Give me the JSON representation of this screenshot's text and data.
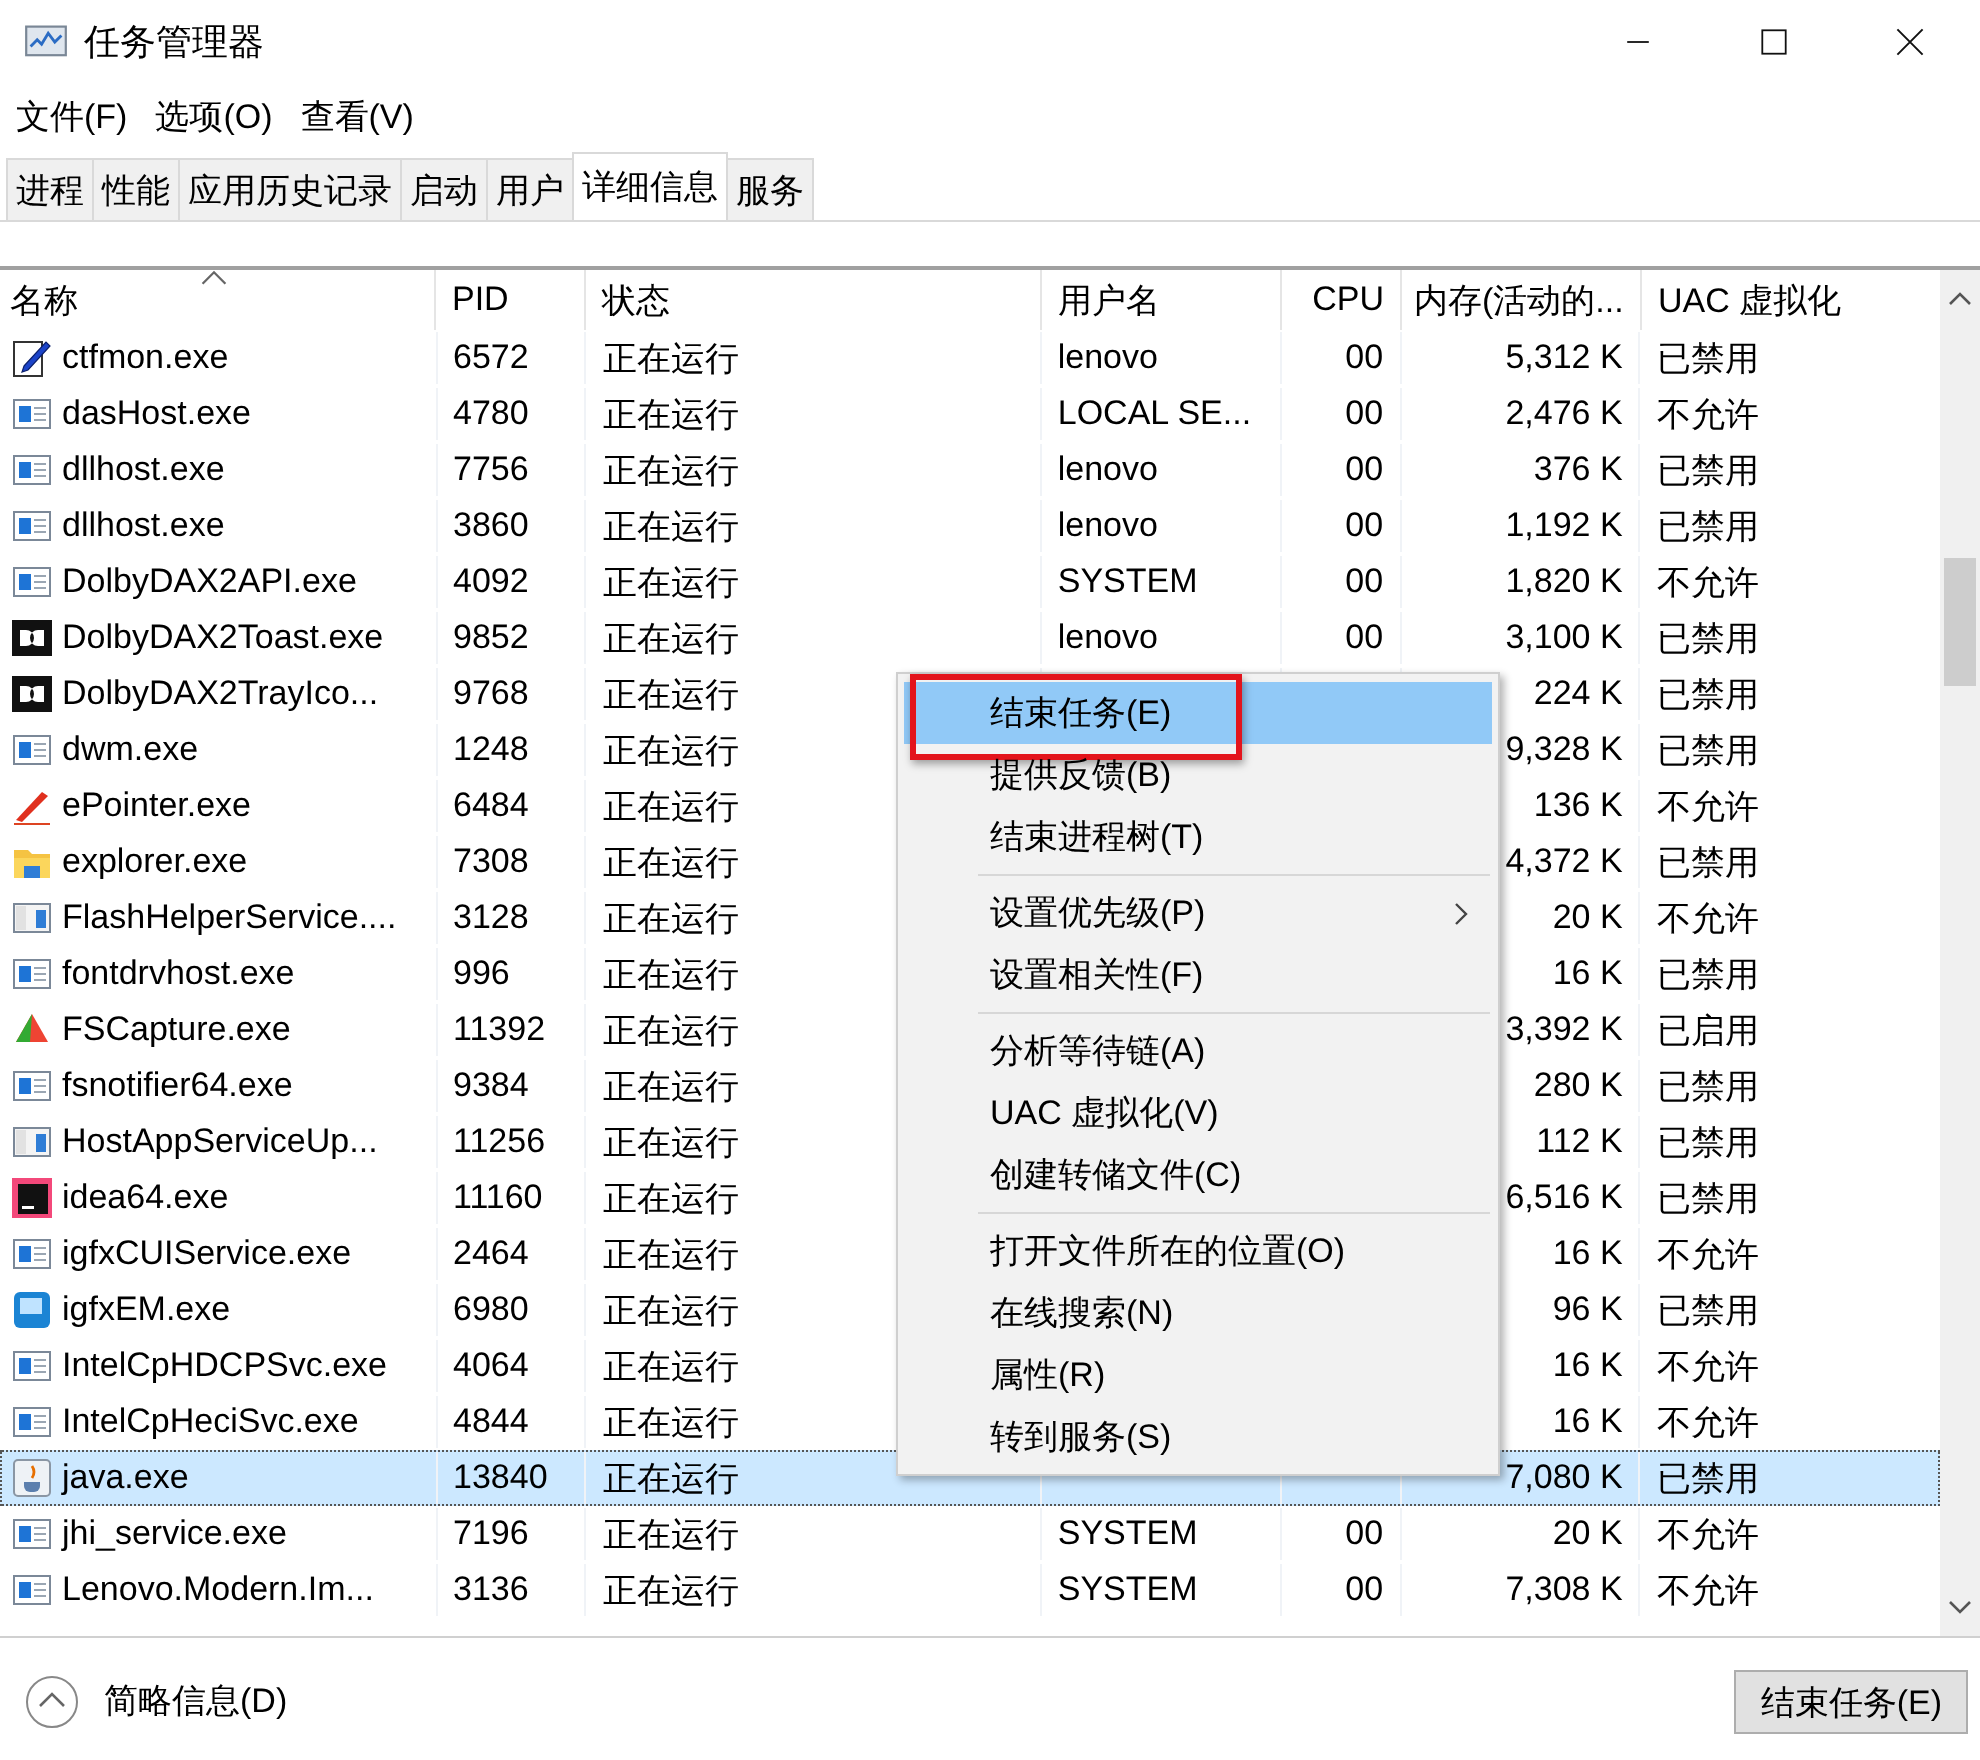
{
  "window": {
    "title": "任务管理器"
  },
  "menu_bar": [
    "文件(F)",
    "选项(O)",
    "查看(V)"
  ],
  "tabs": [
    {
      "label": "进程",
      "selected": false
    },
    {
      "label": "性能",
      "selected": false
    },
    {
      "label": "应用历史记录",
      "selected": false
    },
    {
      "label": "启动",
      "selected": false
    },
    {
      "label": "用户",
      "selected": false
    },
    {
      "label": "详细信息",
      "selected": true
    },
    {
      "label": "服务",
      "selected": false
    }
  ],
  "table": {
    "columns": [
      {
        "label": "名称",
        "sorted": true
      },
      {
        "label": "PID",
        "sorted": false
      },
      {
        "label": "状态",
        "sorted": false
      },
      {
        "label": "用户名",
        "sorted": false
      },
      {
        "label": "CPU",
        "sorted": false
      },
      {
        "label": "内存(活动的...",
        "sorted": false
      },
      {
        "label": "UAC 虚拟化",
        "sorted": false
      }
    ],
    "rows": [
      {
        "kind": "notepad",
        "name": "ctfmon.exe",
        "pid": "6572",
        "status": "正在运行",
        "user": "lenovo",
        "cpu": "00",
        "memory": "5,312 K",
        "uac": "已禁用",
        "selected": false
      },
      {
        "kind": "window",
        "name": "dasHost.exe",
        "pid": "4780",
        "status": "正在运行",
        "user": "LOCAL SE...",
        "cpu": "00",
        "memory": "2,476 K",
        "uac": "不允许",
        "selected": false
      },
      {
        "kind": "window",
        "name": "dllhost.exe",
        "pid": "7756",
        "status": "正在运行",
        "user": "lenovo",
        "cpu": "00",
        "memory": "376 K",
        "uac": "已禁用",
        "selected": false
      },
      {
        "kind": "window",
        "name": "dllhost.exe",
        "pid": "3860",
        "status": "正在运行",
        "user": "lenovo",
        "cpu": "00",
        "memory": "1,192 K",
        "uac": "已禁用",
        "selected": false
      },
      {
        "kind": "window",
        "name": "DolbyDAX2API.exe",
        "pid": "4092",
        "status": "正在运行",
        "user": "SYSTEM",
        "cpu": "00",
        "memory": "1,820 K",
        "uac": "不允许",
        "selected": false
      },
      {
        "kind": "dolby",
        "name": "DolbyDAX2Toast.exe",
        "pid": "9852",
        "status": "正在运行",
        "user": "lenovo",
        "cpu": "00",
        "memory": "3,100 K",
        "uac": "已禁用",
        "selected": false
      },
      {
        "kind": "dolby",
        "name": "DolbyDAX2TrayIco...",
        "pid": "9768",
        "status": "正在运行",
        "memory": "224 K",
        "uac": "已禁用",
        "selected": false
      },
      {
        "kind": "window",
        "name": "dwm.exe",
        "pid": "1248",
        "status": "正在运行",
        "memory": "9,328 K",
        "uac": "已禁用",
        "selected": false
      },
      {
        "kind": "pen",
        "name": "ePointer.exe",
        "pid": "6484",
        "status": "正在运行",
        "memory": "136 K",
        "uac": "不允许",
        "selected": false
      },
      {
        "kind": "folder",
        "name": "explorer.exe",
        "pid": "7308",
        "status": "正在运行",
        "memory": "4,372 K",
        "uac": "已禁用",
        "selected": false
      },
      {
        "kind": "panel",
        "name": "FlashHelperService....",
        "pid": "3128",
        "status": "正在运行",
        "memory": "20 K",
        "uac": "不允许",
        "selected": false
      },
      {
        "kind": "window",
        "name": "fontdrvhost.exe",
        "pid": "996",
        "status": "正在运行",
        "memory": "16 K",
        "uac": "已禁用",
        "selected": false
      },
      {
        "kind": "capture",
        "name": "FSCapture.exe",
        "pid": "11392",
        "status": "正在运行",
        "memory": "3,392 K",
        "uac": "已启用",
        "selected": false
      },
      {
        "kind": "window",
        "name": "fsnotifier64.exe",
        "pid": "9384",
        "status": "正在运行",
        "memory": "280 K",
        "uac": "已禁用",
        "selected": false
      },
      {
        "kind": "panel",
        "name": "HostAppServiceUp...",
        "pid": "11256",
        "status": "正在运行",
        "memory": "112 K",
        "uac": "已禁用",
        "selected": false
      },
      {
        "kind": "ide",
        "name": "idea64.exe",
        "pid": "11160",
        "status": "正在运行",
        "memory": "6,516 K",
        "uac": "已禁用",
        "selected": false
      },
      {
        "kind": "window",
        "name": "igfxCUIService.exe",
        "pid": "2464",
        "status": "正在运行",
        "memory": "16 K",
        "uac": "不允许",
        "selected": false
      },
      {
        "kind": "monitor",
        "name": "igfxEM.exe",
        "pid": "6980",
        "status": "正在运行",
        "memory": "96 K",
        "uac": "已禁用",
        "selected": false
      },
      {
        "kind": "window",
        "name": "IntelCpHDCPSvc.exe",
        "pid": "4064",
        "status": "正在运行",
        "memory": "16 K",
        "uac": "不允许",
        "selected": false
      },
      {
        "kind": "window",
        "name": "IntelCpHeciSvc.exe",
        "pid": "4844",
        "status": "正在运行",
        "memory": "16 K",
        "uac": "不允许",
        "selected": false
      },
      {
        "kind": "java",
        "name": "java.exe",
        "pid": "13840",
        "status": "正在运行",
        "memory": "7,080 K",
        "uac": "已禁用",
        "selected": true
      },
      {
        "kind": "window",
        "name": "jhi_service.exe",
        "pid": "7196",
        "status": "正在运行",
        "user": "SYSTEM",
        "cpu": "00",
        "memory": "20 K",
        "uac": "不允许",
        "selected": false
      },
      {
        "kind": "window",
        "name": "Lenovo.Modern.Im...",
        "pid": "3136",
        "status": "正在运行",
        "user": "SYSTEM",
        "cpu": "00",
        "memory": "7,308 K",
        "uac": "不允许",
        "selected": false
      }
    ]
  },
  "context_menu": {
    "groups": [
      [
        {
          "label": "结束任务(E)",
          "selected": true,
          "outlined": true,
          "submenu": false
        },
        {
          "label": "提供反馈(B)",
          "selected": false,
          "outlined": false,
          "submenu": false
        },
        {
          "label": "结束进程树(T)",
          "selected": false,
          "outlined": false,
          "submenu": false
        }
      ],
      [
        {
          "label": "设置优先级(P)",
          "selected": false,
          "outlined": false,
          "submenu": true
        },
        {
          "label": "设置相关性(F)",
          "selected": false,
          "outlined": false,
          "submenu": false
        }
      ],
      [
        {
          "label": "分析等待链(A)",
          "selected": false,
          "outlined": false,
          "submenu": false
        },
        {
          "label": "UAC 虚拟化(V)",
          "selected": false,
          "outlined": false,
          "submenu": false
        },
        {
          "label": "创建转储文件(C)",
          "selected": false,
          "outlined": false,
          "submenu": false
        }
      ],
      [
        {
          "label": "打开文件所在的位置(O)",
          "selected": false,
          "outlined": false,
          "submenu": false
        },
        {
          "label": "在线搜索(N)",
          "selected": false,
          "outlined": false,
          "submenu": false
        },
        {
          "label": "属性(R)",
          "selected": false,
          "outlined": false,
          "submenu": false
        },
        {
          "label": "转到服务(S)",
          "selected": false,
          "outlined": false,
          "submenu": false
        }
      ]
    ]
  },
  "footer": {
    "details_toggle": "简略信息(D)",
    "end_task_button": "结束任务(E)"
  }
}
